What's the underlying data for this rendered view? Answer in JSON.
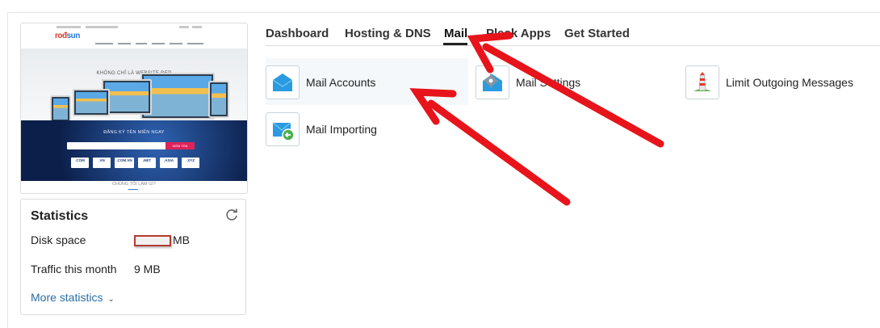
{
  "tabs": [
    {
      "label": "Dashboard",
      "active": false
    },
    {
      "label": "Hosting & DNS",
      "active": false
    },
    {
      "label": "Mail",
      "active": true
    },
    {
      "label": "Plesk Apps",
      "active": false
    },
    {
      "label": "Get Started",
      "active": false
    }
  ],
  "mail_tools": [
    {
      "label": "Mail Accounts",
      "icon": "envelope-icon"
    },
    {
      "label": "Mail Settings",
      "icon": "mail-settings-gear-icon"
    },
    {
      "label": "Limit Outgoing Messages",
      "icon": "lighthouse-icon"
    },
    {
      "label": "Mail Importing",
      "icon": "mail-import-icon"
    }
  ],
  "preview": {
    "logo_red": "rođ",
    "logo_blue": "sun",
    "hero_title": "KHÔNG CHỈ LÀ WEBSITE ĐẸP",
    "dark_title": "ĐĂNG KÝ TÊN MIỀN NGAY",
    "search_button": "KIỂM TRA",
    "tlds": [
      ".COM",
      ".VN",
      ".COM.VN",
      ".NET",
      ".ASIA",
      ".XYZ"
    ],
    "bottom_text": "CHÚNG TÔI LÀM GÌ?"
  },
  "statistics": {
    "title": "Statistics",
    "disk_label": "Disk space",
    "disk_unit": "MB",
    "traffic_label": "Traffic this month",
    "traffic_value": "9 MB",
    "more_label": "More statistics",
    "refresh_icon": "refresh-icon"
  },
  "colors": {
    "accent_blue": "#2a6fa5",
    "annotation_red": "#e8141b",
    "icon_blue": "#2a9be0"
  }
}
